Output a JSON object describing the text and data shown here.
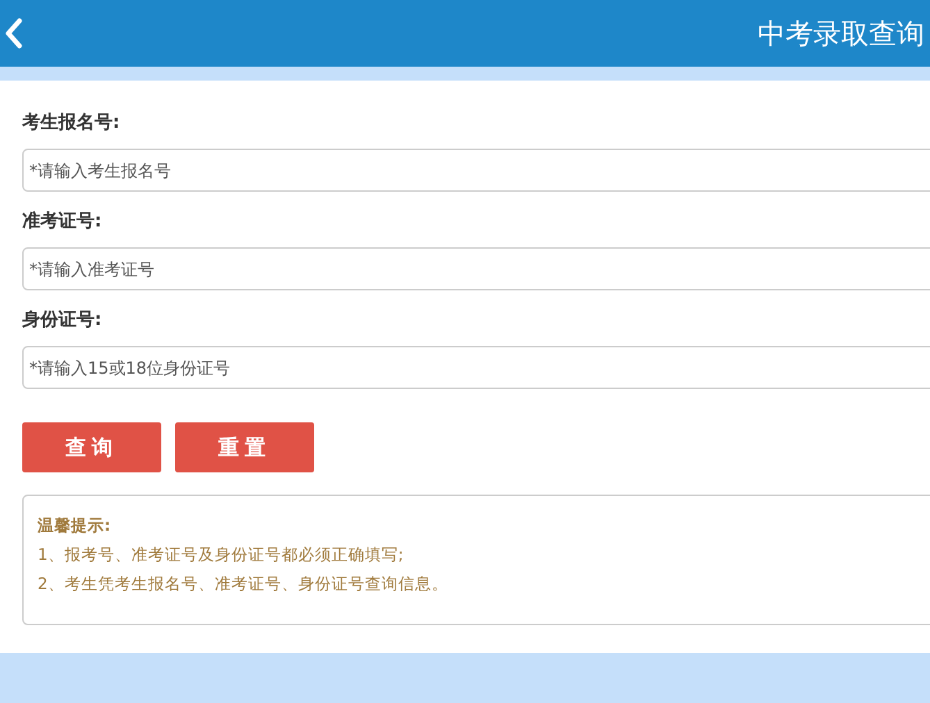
{
  "header": {
    "title": "中考录取查询"
  },
  "fields": [
    {
      "label": "考生报名号:",
      "placeholder": "*请输入考生报名号"
    },
    {
      "label": "准考证号:",
      "placeholder": "*请输入准考证号"
    },
    {
      "label": "身份证号:",
      "placeholder": "*请输入15或18位身份证号"
    }
  ],
  "buttons": [
    "查询",
    "重置"
  ],
  "notice": {
    "title": "温馨提示:",
    "lines": [
      "1、报考号、准考证号及身份证号都必须正确填写;",
      "2、考生凭考生报名号、准考证号、身份证号查询信息。"
    ]
  }
}
